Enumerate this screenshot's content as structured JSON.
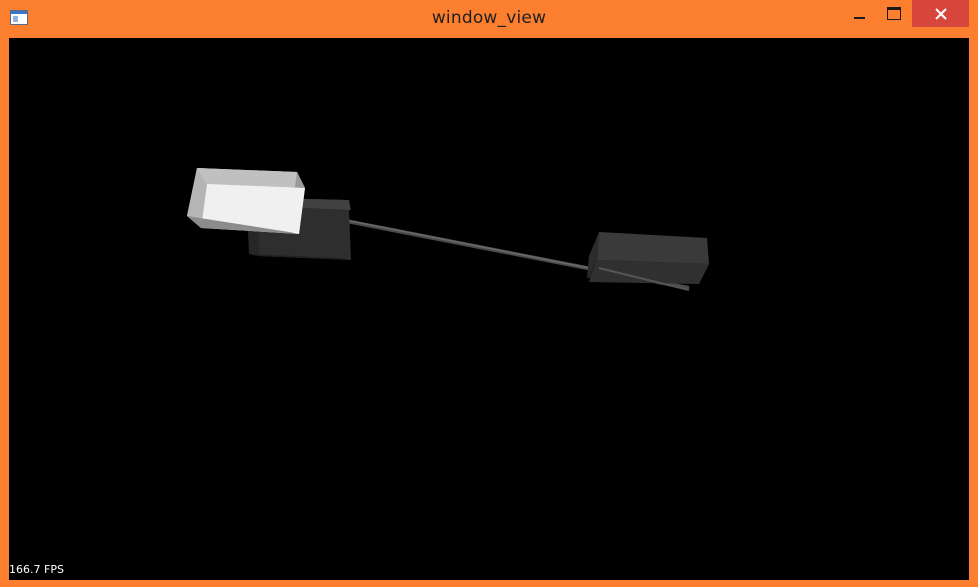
{
  "window": {
    "title": "window_view",
    "controls": {
      "minimize": "minimize",
      "maximize": "maximize",
      "close": "close"
    }
  },
  "viewport": {
    "background": "#000000",
    "fps_readout": "166.7 FPS"
  },
  "colors": {
    "titlebar": "#fb7f2f",
    "close_button": "#d6463c",
    "selected_box": "#e6e6e6",
    "box": "#3a3a3a",
    "link": "#4a4a4a"
  },
  "icons": {
    "app": "window-app-icon",
    "minimize": "minimize-icon",
    "maximize": "maximize-icon",
    "close": "close-icon"
  }
}
